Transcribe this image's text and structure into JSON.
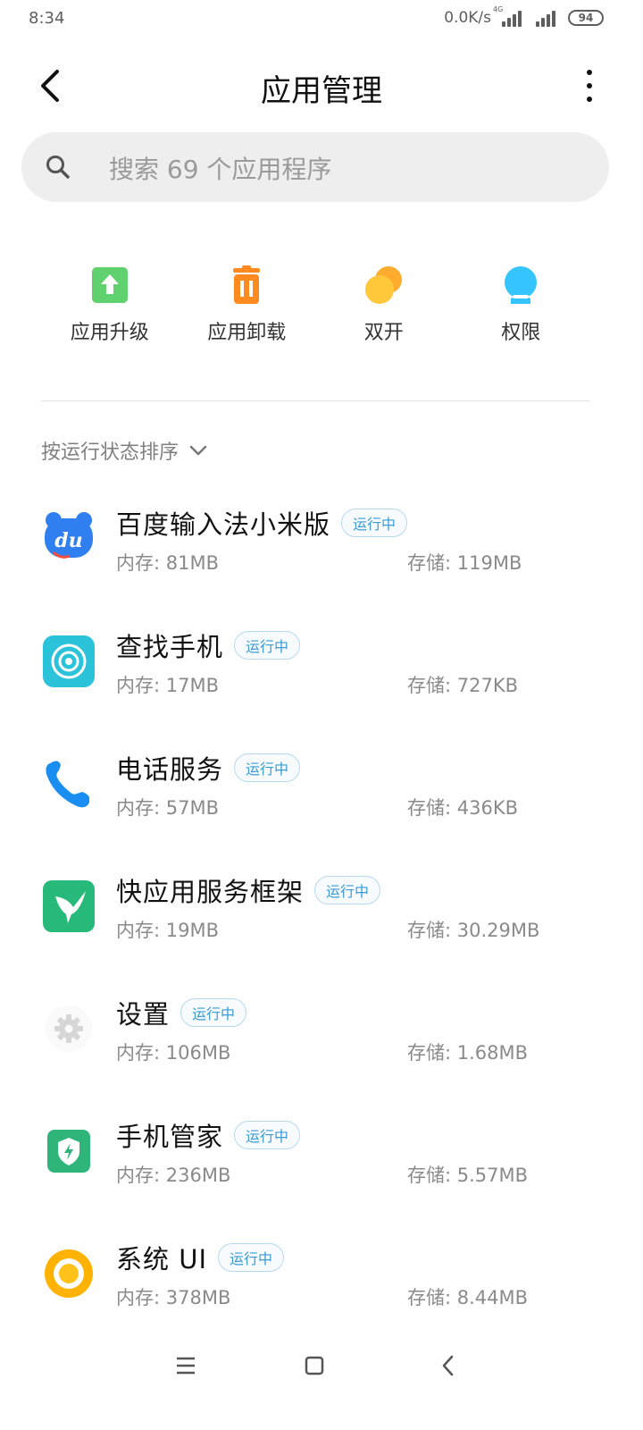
{
  "status": {
    "time": "8:34",
    "net_speed": "0.0K/s",
    "network_type": "4G",
    "battery": "94"
  },
  "header": {
    "title": "应用管理"
  },
  "search": {
    "placeholder": "搜索 69 个应用程序"
  },
  "quick_actions": [
    {
      "label": "应用升级",
      "icon": "upgrade-icon",
      "color": "#5fd16f"
    },
    {
      "label": "应用卸载",
      "icon": "trash-icon",
      "color": "#ff8a1f"
    },
    {
      "label": "双开",
      "icon": "dual-app-icon",
      "color": "#ffc02e"
    },
    {
      "label": "权限",
      "icon": "permission-icon",
      "color": "#36c4ff"
    }
  ],
  "sort": {
    "label": "按运行状态排序"
  },
  "apps": [
    {
      "name": "百度输入法小米版",
      "badge": "运行中",
      "memory": "内存:  81MB",
      "storage": "存储:  119MB",
      "icon": "baidu-input-icon"
    },
    {
      "name": "查找手机",
      "badge": "运行中",
      "memory": "内存:  17MB",
      "storage": "存储:  727KB",
      "icon": "find-phone-icon"
    },
    {
      "name": "电话服务",
      "badge": "运行中",
      "memory": "内存:  57MB",
      "storage": "存储:  436KB",
      "icon": "phone-service-icon"
    },
    {
      "name": "快应用服务框架",
      "badge": "运行中",
      "memory": "内存:  19MB",
      "storage": "存储:  30.29MB",
      "icon": "quick-app-icon"
    },
    {
      "name": "设置",
      "badge": "运行中",
      "memory": "内存:  106MB",
      "storage": "存储:  1.68MB",
      "icon": "settings-icon"
    },
    {
      "name": "手机管家",
      "badge": "运行中",
      "memory": "内存:  236MB",
      "storage": "存储:  5.57MB",
      "icon": "security-icon"
    },
    {
      "name": "系统 UI",
      "badge": "运行中",
      "memory": "内存:  378MB",
      "storage": "存储:  8.44MB",
      "icon": "system-ui-icon"
    }
  ],
  "nav": {
    "buttons": [
      "menu-icon",
      "home-icon",
      "back-icon"
    ]
  },
  "colors": {
    "badge_text": "#3a9bd5",
    "badge_border": "#b7d9ee",
    "search_bg": "#eeeeee"
  }
}
